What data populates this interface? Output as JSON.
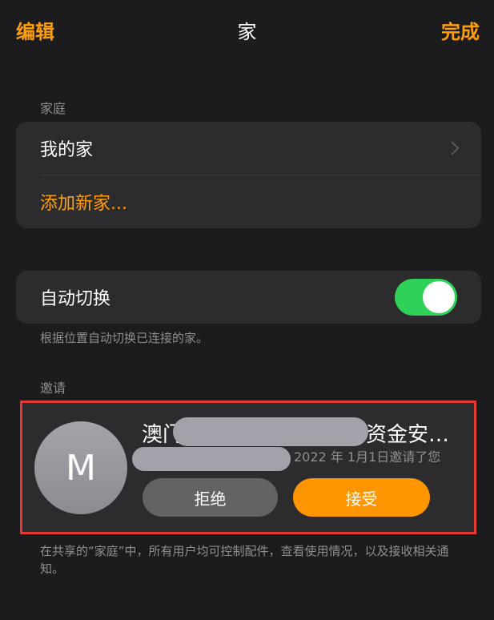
{
  "nav": {
    "edit_label": "编辑",
    "title": "家",
    "done_label": "完成"
  },
  "homes_section": {
    "header": "家庭",
    "items": [
      {
        "label": "我的家"
      },
      {
        "label": "添加新家..."
      }
    ]
  },
  "auto_switch": {
    "label": "自动切换",
    "enabled": true,
    "footnote": "根据位置自动切换已连接的家。"
  },
  "invitations": {
    "header": "邀请",
    "invite": {
      "avatar_letter": "M",
      "name_start": "澳门",
      "name_end": "资金安…",
      "date_text": "2022 年 1月1日邀请了您",
      "decline_label": "拒绝",
      "accept_label": "接受"
    },
    "footnote": "在共享的“家庭”中，所有用户均可控制配件，查看使用情况，以及接收相关通知。"
  },
  "colors": {
    "accent": "#ff9f0a",
    "toggle_on": "#30d158",
    "highlight_border": "#e53935"
  }
}
